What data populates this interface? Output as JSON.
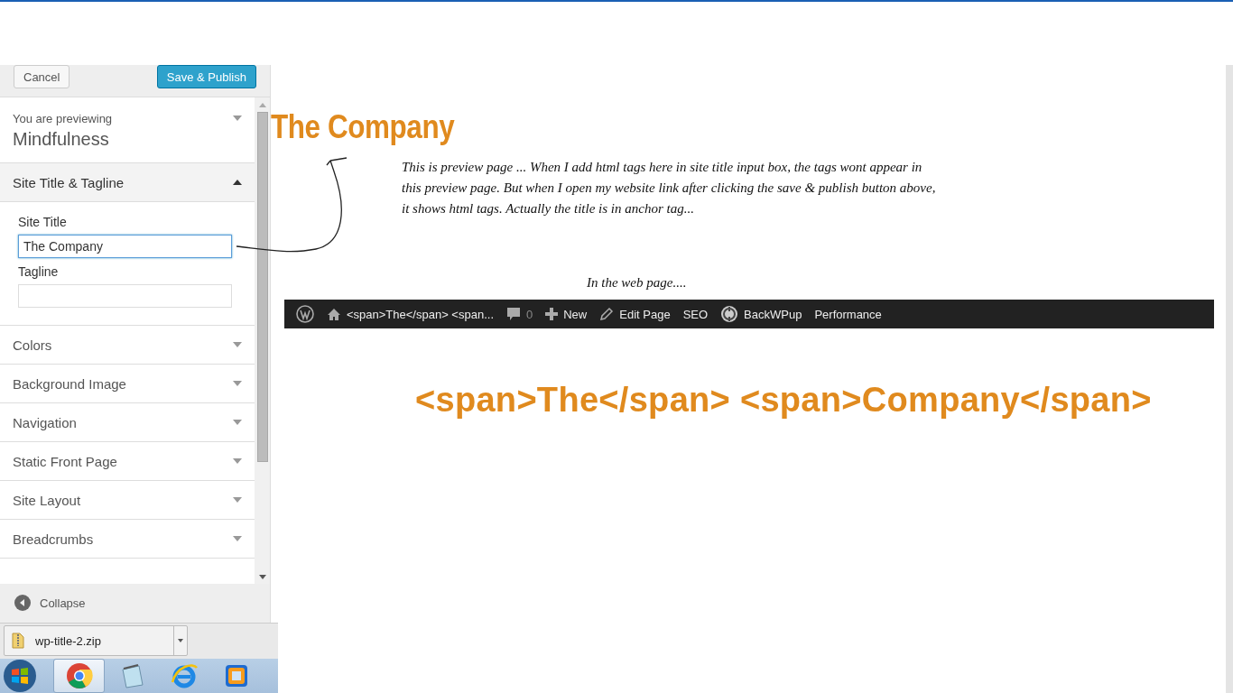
{
  "header": {
    "buttons": [
      {
        "label": "Cancel",
        "kind": "secondary"
      },
      {
        "label": "Save & Publish",
        "kind": "primary"
      }
    ]
  },
  "theme": {
    "caption": "You are previewing",
    "name": "Mindfulness",
    "expanded": false
  },
  "sections": [
    {
      "title": "Site Title & Tagline",
      "expanded": true,
      "fields": [
        {
          "label": "Site Title",
          "value": "The Company",
          "focused": true
        },
        {
          "label": "Tagline",
          "focused": false
        }
      ]
    },
    {
      "title": "Colors",
      "expanded": false
    },
    {
      "title": "Background Image",
      "expanded": false
    },
    {
      "title": "Navigation",
      "expanded": false
    },
    {
      "title": "Static Front Page",
      "expanded": false
    },
    {
      "title": "Site Layout",
      "expanded": false
    },
    {
      "title": "Breadcrumbs",
      "expanded": false
    }
  ],
  "collapse": {
    "label": "Collapse"
  },
  "download": {
    "filename": "wp-title-2.zip"
  },
  "taskbar": {
    "apps": [
      {
        "kind": "browser",
        "selected": true
      },
      {
        "kind": "notepad",
        "selected": false
      },
      {
        "kind": "explorer",
        "selected": false
      },
      {
        "kind": "vm",
        "selected": false
      }
    ]
  },
  "preview": {
    "site_title": "The Company",
    "note": [
      "This is preview page ... When I add html tags here in site title input box, the tags wont appear in",
      "this preview page.  But when I open my website link after clicking the save & publish button above,",
      "it shows html tags.   Actually the title is in anchor tag..."
    ],
    "caption": "In the web page....",
    "admin_bar": [
      {
        "kind": "logo"
      },
      {
        "kind": "home",
        "label": "<span>The</span> <span..."
      },
      {
        "kind": "comments",
        "label": "0"
      },
      {
        "kind": "new",
        "label": "New"
      },
      {
        "kind": "edit",
        "label": "Edit Page"
      },
      {
        "kind": "text",
        "label": "SEO"
      },
      {
        "kind": "backup",
        "label": "BackWPup"
      },
      {
        "kind": "text",
        "label": "Performance"
      }
    ],
    "live_title": "<span>The</span> <span>Company</span>"
  }
}
